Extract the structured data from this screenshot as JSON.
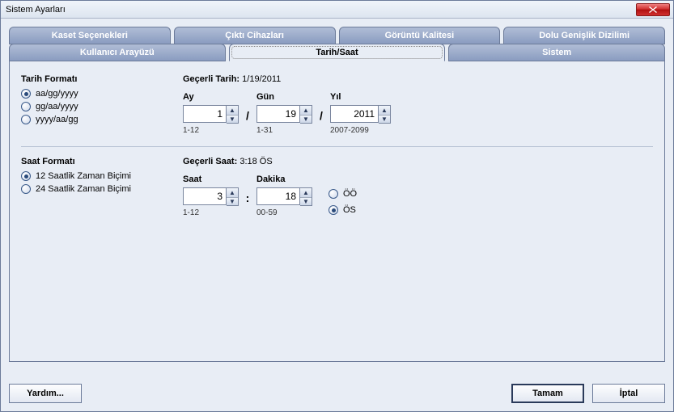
{
  "window": {
    "title": "Sistem Ayarları"
  },
  "tabs_row1": [
    {
      "label": "Kaset Seçenekleri"
    },
    {
      "label": "Çıktı Cihazları"
    },
    {
      "label": "Görüntü Kalitesi"
    },
    {
      "label": "Dolu Genişlik Dizilimi"
    }
  ],
  "tabs_row2": [
    {
      "label": "Kullanıcı Arayüzü"
    },
    {
      "label": "Tarih/Saat",
      "active": true
    },
    {
      "label": "Sistem"
    }
  ],
  "date_format": {
    "title": "Tarih Formatı",
    "options": [
      {
        "label": "aa/gg/yyyy",
        "checked": true
      },
      {
        "label": "gg/aa/yyyy",
        "checked": false
      },
      {
        "label": "yyyy/aa/gg",
        "checked": false
      }
    ]
  },
  "time_format": {
    "title": "Saat Formatı",
    "options": [
      {
        "label": "12 Saatlik Zaman Biçimi",
        "checked": true
      },
      {
        "label": "24 Saatlik Zaman Biçimi",
        "checked": false
      }
    ]
  },
  "current_date": {
    "label": "Geçerli Tarih:",
    "value": "1/19/2011",
    "month": {
      "label": "Ay",
      "value": "1",
      "hint": "1-12"
    },
    "day": {
      "label": "Gün",
      "value": "19",
      "hint": "1-31"
    },
    "year": {
      "label": "Yıl",
      "value": "2011",
      "hint": "2007-2099"
    },
    "sep": "/"
  },
  "current_time": {
    "label": "Geçerli Saat:",
    "value": "3:18 ÖS",
    "hour": {
      "label": "Saat",
      "value": "3",
      "hint": "1-12"
    },
    "minute": {
      "label": "Dakika",
      "value": "18",
      "hint": "00-59"
    },
    "sep": ":",
    "ampm": [
      {
        "label": "ÖÖ",
        "checked": false
      },
      {
        "label": "ÖS",
        "checked": true
      }
    ]
  },
  "buttons": {
    "help": "Yardım...",
    "ok": "Tamam",
    "cancel": "İptal"
  }
}
